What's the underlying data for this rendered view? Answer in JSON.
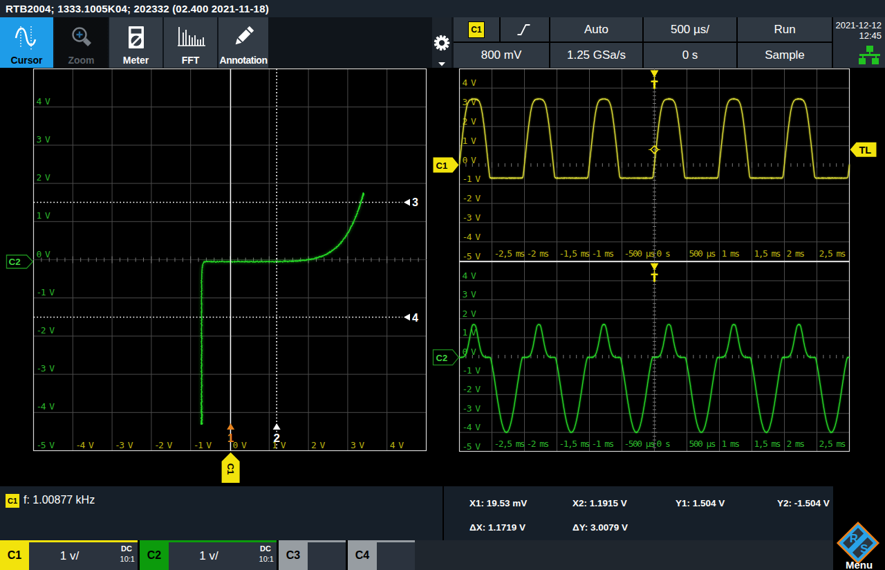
{
  "title_bar": {
    "text": "RTB2004; 1333.1005K04; 202332 (02.400 2021-11-18)"
  },
  "toolbar": {
    "buttons": [
      {
        "id": "cursor",
        "label": "Cursor",
        "state": "active"
      },
      {
        "id": "zoom",
        "label": "Zoom",
        "state": "disabled"
      },
      {
        "id": "meter",
        "label": "Meter",
        "state": "normal"
      },
      {
        "id": "fft",
        "label": "FFT",
        "state": "normal"
      },
      {
        "id": "annotation",
        "label": "Annotation",
        "state": "normal"
      }
    ]
  },
  "status": {
    "trigger_source_badge": "C1",
    "trigger_mode": "Auto",
    "timebase": "500 µs/",
    "acquisition_state": "Run",
    "trigger_level": "800 mV",
    "sample_rate": "1.25 GSa/s",
    "horizontal_position": "0 s",
    "acquisition_mode": "Sample",
    "date": "2021-12-12",
    "time": "12:45"
  },
  "measurements": {
    "source_badge": "C1",
    "frequency_text": "f: 1.00877 kHz",
    "cursor_results": {
      "x1": "X1: 19.53 mV",
      "x2": "X2: 1.1915 V",
      "y1": "Y1: 1.504 V",
      "y2": "Y2: -1.504 V",
      "dx": "ΔX: 1.1719 V",
      "dy": "ΔY: 3.0079 V"
    }
  },
  "channel_bar": {
    "channels": [
      {
        "name": "C1",
        "scale": "1 v/",
        "coupling": "DC",
        "probe": "10:1",
        "color": "#f2e30c",
        "enabled": true
      },
      {
        "name": "C2",
        "scale": "1 v/",
        "coupling": "DC",
        "probe": "10:1",
        "color": "#0c9b0c",
        "enabled": true
      },
      {
        "name": "C3",
        "scale": "",
        "coupling": "",
        "probe": "",
        "color": "#979da2",
        "enabled": false
      },
      {
        "name": "C4",
        "scale": "",
        "coupling": "",
        "probe": "",
        "color": "#979da2",
        "enabled": false
      }
    ],
    "menu_label": "Menu",
    "menu_logo": {
      "letter_r": "R",
      "letter_s": "S"
    }
  },
  "colors": {
    "c1_trace": "#e8e838",
    "c2_trace": "#28e028",
    "c1_label": "#bdb413",
    "c2_label": "#2cb42c",
    "grid": "#4c4c4c",
    "grid_border": "#d8d8d8",
    "tick": "#7a7a7a",
    "cursor1_marker": "#e6831e",
    "accent_blue": "#1e9ce8",
    "pennant_yellow": "#f2e30c"
  },
  "chart_data": [
    {
      "type": "scatter",
      "name": "xy-view",
      "x_channel": "C1",
      "y_channel": "C2",
      "x_ticks": [
        "-4 V",
        "-3 V",
        "-2 V",
        "-1 V",
        "0 V",
        "1 V",
        "2 V",
        "3 V",
        "4 V"
      ],
      "y_ticks": [
        "4 V",
        "3 V",
        "2 V",
        "1 V",
        "0 V",
        "-1 V",
        "-2 V",
        "-3 V",
        "-4 V",
        "-5 V"
      ],
      "x_range_v": [
        -5,
        5
      ],
      "y_range_v": [
        -5,
        5
      ],
      "volts_per_div": 1,
      "trace_model": {
        "clamp_v": -0.72,
        "source_amp_v": 4.2,
        "source_off_v": -0.8,
        "response_peak_v": 1.78,
        "response_power": 8.5,
        "base_v": -0.05,
        "c2_min_v": -4.3,
        "c1_peak_v": 3.4
      },
      "cursors": {
        "x1_v": 0.01953,
        "x2_v": 1.1915,
        "y1_v": 1.504,
        "y2_v": -1.504,
        "marker1": "1",
        "marker2": "2",
        "marker3": "3",
        "marker4": "4"
      },
      "pennants": {
        "y_axis": "C2",
        "x_axis": "C1"
      }
    },
    {
      "type": "line",
      "name": "c1-time",
      "channel": "C1",
      "x_ticks": [
        "-2,5 ms",
        "-2 ms",
        "-1,5 ms",
        "-1 ms",
        "-500 µs",
        "0 s",
        "500 µs",
        "1 ms",
        "1,5 ms",
        "2 ms",
        "2,5 ms"
      ],
      "y_ticks": [
        "4 V",
        "3 V",
        "2 V",
        "1 V",
        "0 V",
        "-1 V",
        "-2 V",
        "-3 V",
        "-4 V",
        "-5 V"
      ],
      "time_range_ms": [
        -3,
        3
      ],
      "y_range_v": [
        -5,
        5
      ],
      "time_per_div_ms": 0.5,
      "volts_per_div": 1,
      "waveform": {
        "kind": "clipped_sine",
        "freq_khz": 1.00877,
        "amplitude_v": 5.3,
        "offset_v": -0.9,
        "clip_min_v": -0.68,
        "clip_max_v": 3.47,
        "peak_time_ms": 0.222,
        "period_ms": 1.0
      },
      "trigger": {
        "level_v": 0.8,
        "position_ms": 0,
        "label": "TL"
      },
      "pennant": "C1"
    },
    {
      "type": "line",
      "name": "c2-time",
      "channel": "C2",
      "x_ticks": [
        "-2,5 ms",
        "-2 ms",
        "-1,5 ms",
        "-1 ms",
        "-500 µs",
        "0 s",
        "500 µs",
        "1 ms",
        "1,5 ms",
        "2 ms",
        "2,5 ms"
      ],
      "y_ticks": [
        "4 V",
        "3 V",
        "2 V",
        "1 V",
        "0 V",
        "-1 V",
        "-2 V",
        "-3 V",
        "-4 V",
        "-5 V"
      ],
      "time_range_ms": [
        -3,
        3
      ],
      "y_range_v": [
        -5,
        5
      ],
      "time_per_div_ms": 0.5,
      "volts_per_div": 1,
      "waveform": {
        "kind": "diode_response",
        "freq_khz": 1.00877,
        "hump_peak_v": 1.7,
        "base_v": -0.04,
        "trough_v": -4.0,
        "hump_power": 6.5,
        "dip_start_v": -0.95,
        "dip_power": 1.35,
        "peak_time_ms": 0.222,
        "period_ms": 1.0
      },
      "trigger": {
        "position_ms": 0
      },
      "pennant": "C2"
    }
  ]
}
